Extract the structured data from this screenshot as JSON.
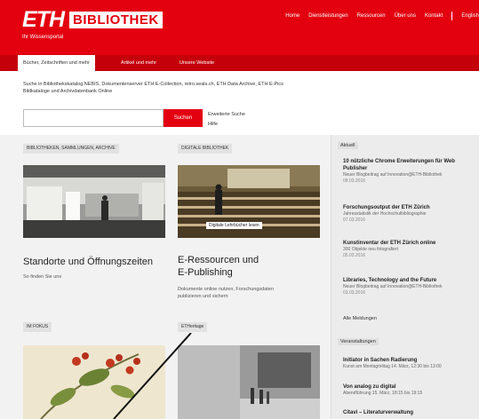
{
  "header": {
    "logo_eth": "ETH",
    "logo_bib": "BIBLIOTHEK",
    "subtitle": "Ihr Wissensportal",
    "nav": [
      "Home",
      "Dienstleistungen",
      "Ressourcen",
      "Über uns",
      "Kontakt",
      "English"
    ]
  },
  "subnav": {
    "tabs": [
      "Bücher, Zeitschriften und mehr",
      "Artikel und mehr",
      "Unsere Website"
    ]
  },
  "intro": {
    "line1": "Suche in Bibliothekskatalog NEBIS, Dokumentenserver ETH E-Collection, retro.seals.ch, ETH Data Archive, ETH E-Pics",
    "line2": "Bildkataloge und Archivdatenbank Online"
  },
  "search": {
    "placeholder": "",
    "button": "Suchen",
    "advanced": "Erweiterte Suche",
    "help": "Hilfe"
  },
  "cards": {
    "libraries": {
      "label": "BIBLIOTHEKEN, SAMMLUNGEN, ARCHIVE",
      "title": "Standorte und Öffnungszeiten",
      "text": "So finden Sie uns"
    },
    "digital": {
      "label": "DIGITALE BIBLIOTHEK",
      "caption": "Digitale Lehrbücher lesen",
      "title1": "E-Ressourcen und",
      "title2": "E-Publishing",
      "text1": "Dokumente online nutzen, Forschungsdaten",
      "text2": "publizieren und sichern"
    },
    "focus_label": "IM FOKUS",
    "heritage_label": "ETHeritage"
  },
  "sidebar": {
    "aktuell_label": "Aktuell",
    "news": [
      {
        "title": "10 nützliche Chrome Erweiterungen für Web Publisher",
        "sub": "Neuer Blogbeitrag auf Innovation@ETH-Bibliothek",
        "date": "08.03.2016"
      },
      {
        "title": "Forschungsoutput der ETH Zürich",
        "sub": "Jahresstatistik der Hochschulbibliographie",
        "date": "07.03.2016"
      },
      {
        "title": "Kunstinventar der ETH Zürich online",
        "sub": "300 Objekte neu fotografiert",
        "date": "05.03.2016"
      },
      {
        "title": "Libraries, Technology and the Future",
        "sub": "Neuer Blogbeitrag auf Innovation@ETH-Bibliothek",
        "date": "03.03.2016"
      }
    ],
    "all_news": "Alle Meldungen",
    "events_label": "Veranstaltungen",
    "events": [
      {
        "title": "Initiator in Sachen Radierung",
        "sub": "Kunst am Montagmittag 14. März, 12:30 bis 13:00"
      },
      {
        "title": "Von analog zu digital",
        "sub": "Abendführung 15. März, 18:15 bis 19:15"
      },
      {
        "title": "Citavi – Literaturverwaltung",
        "sub": ""
      }
    ]
  },
  "colors": {
    "brand_red": "#e3000f",
    "subnav_red": "#c4000b"
  }
}
